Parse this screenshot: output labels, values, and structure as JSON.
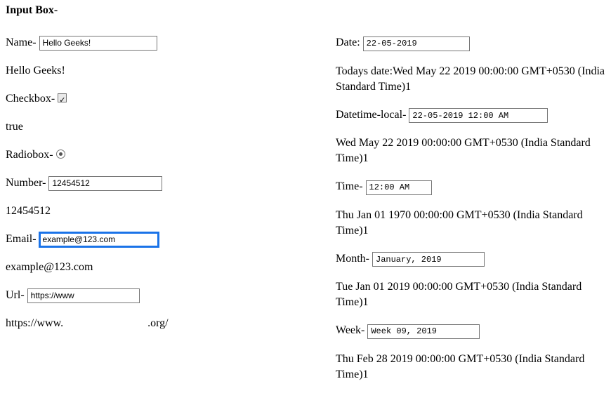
{
  "heading": "Input Box-",
  "left": {
    "name_label": "Name- ",
    "name_value": "Hello Geeks!",
    "name_echo": "Hello Geeks!",
    "checkbox_label": "Checkbox- ",
    "checkbox_echo": "true",
    "radio_label": "Radiobox- ",
    "number_label": "Number- ",
    "number_value": "12454512",
    "number_echo": "12454512",
    "email_label": "Email- ",
    "email_value": "example@123.com",
    "email_echo": "example@123.com",
    "url_label": "Url- ",
    "url_value": "https://www",
    "url_echo_prefix": "https://www.",
    "url_echo_suffix": ".org/"
  },
  "right": {
    "date_label": "Date: ",
    "date_value": "22-05-2019",
    "date_echo": "Todays date:Wed May 22 2019 00:00:00 GMT+0530 (India Standard Time)1",
    "dtl_label": "Datetime-local- ",
    "dtl_value": "22-05-2019 12:00 AM",
    "dtl_echo": "Wed May 22 2019 00:00:00 GMT+0530 (India Standard Time)1",
    "time_label": "Time- ",
    "time_value": "12:00 AM",
    "time_echo": "Thu Jan 01 1970 00:00:00 GMT+0530 (India Standard Time)1",
    "month_label": "Month- ",
    "month_value": "January, 2019",
    "month_echo": "Tue Jan 01 2019 00:00:00 GMT+0530 (India Standard Time)1",
    "week_label": "Week- ",
    "week_value": "Week 09, 2019",
    "week_echo": "Thu Feb 28 2019 00:00:00 GMT+0530 (India Standard Time)1"
  }
}
